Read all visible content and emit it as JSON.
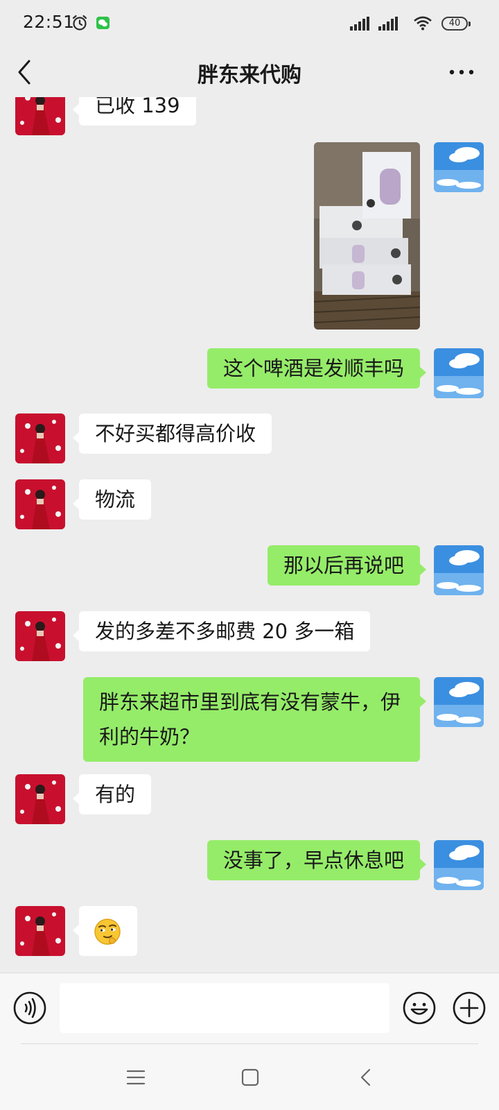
{
  "status_bar": {
    "time": "22:51",
    "battery": "40",
    "icons": [
      "alarm-icon",
      "wechat-notification-icon",
      "signal-icon",
      "signal-icon",
      "wifi-icon",
      "battery-icon"
    ]
  },
  "header": {
    "title": "胖东来代购",
    "back_icon": "chevron-left-icon",
    "more_icon": "more-dots-icon"
  },
  "messages": [
    {
      "sender": "peer",
      "type": "text",
      "text": "已收 139"
    },
    {
      "sender": "me",
      "type": "image",
      "description": "photo"
    },
    {
      "sender": "me",
      "type": "text",
      "text": "这个啤酒是发顺丰吗"
    },
    {
      "sender": "peer",
      "type": "text",
      "text": "不好买都得高价收"
    },
    {
      "sender": "peer",
      "type": "text",
      "text": "物流"
    },
    {
      "sender": "me",
      "type": "text",
      "text": "那以后再说吧"
    },
    {
      "sender": "peer",
      "type": "text",
      "text": "发的多差不多邮费 20 多一箱"
    },
    {
      "sender": "me",
      "type": "text",
      "text": "胖东来超市里到底有没有蒙牛，伊利的牛奶？"
    },
    {
      "sender": "peer",
      "type": "text",
      "text": "有的"
    },
    {
      "sender": "me",
      "type": "text",
      "text": "没事了，早点休息吧"
    },
    {
      "sender": "peer",
      "type": "emoji",
      "emoji": "smirk-emoji"
    }
  ],
  "input_bar": {
    "placeholder": "",
    "voice_icon": "voice-icon",
    "emoji_icon": "emoji-smile-icon",
    "plus_icon": "plus-icon"
  },
  "system_nav": {
    "icons": [
      "menu-icon",
      "home-square-icon",
      "back-triangle-icon"
    ]
  },
  "colors": {
    "background": "#ededed",
    "my_bubble": "#95ec69",
    "peer_bubble": "#ffffff",
    "title_text": "#191919"
  }
}
